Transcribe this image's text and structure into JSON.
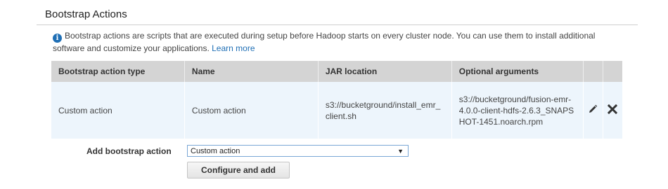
{
  "section": {
    "title": "Bootstrap Actions"
  },
  "info": {
    "text": "Bootstrap actions are scripts that are executed during setup before Hadoop starts on every cluster node. You can use them to install additional software and customize your applications.",
    "link": "Learn more"
  },
  "table": {
    "headers": [
      "Bootstrap action type",
      "Name",
      "JAR location",
      "Optional arguments"
    ],
    "rows": [
      {
        "type": "Custom action",
        "name": "Custom action",
        "jar_location": "s3://bucketground/install_emr_client.sh",
        "optional_arguments": "s3://bucketground/fusion-emr-4.0.0-client-hdfs-2.6.3_SNAPSHOT-1451.noarch.rpm"
      }
    ],
    "row_icons": [
      "pencil-icon",
      "close-icon"
    ]
  },
  "add": {
    "label": "Add bootstrap action",
    "select_value": "Custom action",
    "button_label": "Configure and add"
  },
  "colors": {
    "header_bg": "#d4d4d4",
    "row_bg": "#edf5fc",
    "link": "#1f6fb5",
    "select_border": "#7aa7d6"
  }
}
